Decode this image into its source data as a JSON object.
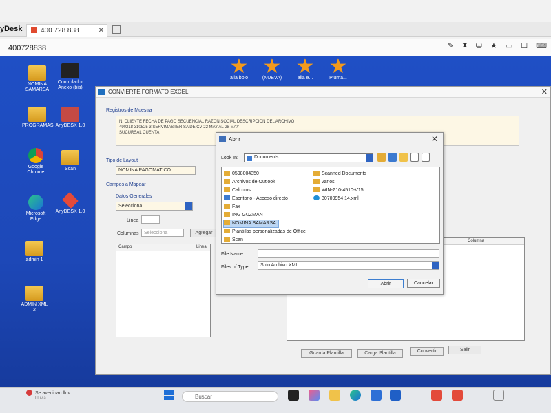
{
  "anydesk": {
    "brand": "yDesk",
    "tab_label": "400 728 838",
    "address": "400728838",
    "toolbar_icons": [
      "edit-icon",
      "hourglass-icon",
      "database-icon",
      "star-icon",
      "monitor-icon",
      "chat-icon",
      "keyboard-icon"
    ]
  },
  "desktop": {
    "left_icons": [
      {
        "label": "NOMINA SAMARSA",
        "icon": "folder-icon"
      },
      {
        "label": "Controlador Anexo (bis)",
        "icon": "app-icon"
      },
      {
        "label": "PROGRAMAS",
        "icon": "folder-icon"
      },
      {
        "label": "AnyDESK 1.0",
        "icon": "app-icon"
      },
      {
        "label": "Google Chrome",
        "icon": "chrome-icon"
      },
      {
        "label": "Scan",
        "icon": "folder-icon"
      },
      {
        "label": "Microsoft Edge",
        "icon": "edge-icon"
      },
      {
        "label": "AnyDESK 1.0",
        "icon": "anydesk-icon"
      },
      {
        "label": "admin 1",
        "icon": "folder-icon"
      },
      {
        "label": "ADMIN XML 2",
        "icon": "folder-icon"
      }
    ],
    "top_icons": [
      {
        "label": "alla bolo"
      },
      {
        "label": "(NUEVA)"
      },
      {
        "label": "alla e..."
      },
      {
        "label": "Pluma..."
      }
    ]
  },
  "app": {
    "title": "CONVIERTE FORMATO EXCEL",
    "registros_label": "Registros de Muestra",
    "sample_line1": "N. CLIENTE FECHA DE PAGO SECUENCIAL RAZON SOCIAL DESCRIPCION DEL ARCHIVO",
    "sample_line2": "490218 310525 3 SERVIMASTER SA DE CV 22 MAY AL 28 MAY",
    "sample_line3": "SUCURSAL CUENTA",
    "tipo_layout_label": "Tipo de Layout",
    "tipo_layout_value": "NOMINA PAGOMATICO",
    "campos_label": "Campos a Mapear",
    "datos_generales_label": "Datos Generales",
    "datos_generales_value": "Selecciona",
    "linea_label": "Linea",
    "columnas_label": "Columnas",
    "columnas_value": "Selecciona",
    "grid_col_campo": "Campo",
    "grid_col_linea": "Linea",
    "grid_col_columna": "Columna",
    "btn_agregar": "Agregar",
    "btn_guardar": "Guarda Plantilla",
    "btn_carga": "Carga Plantilla",
    "btn_convertir": "Convertir",
    "btn_salir": "Salir"
  },
  "dialog": {
    "title": "Abrir",
    "look_in_label": "Look In:",
    "look_in_value": "Documents",
    "left_items": [
      {
        "name": "0598004350",
        "type": "folder"
      },
      {
        "name": "Archivos de Outlook",
        "type": "folder"
      },
      {
        "name": "Calculos",
        "type": "folder"
      },
      {
        "name": "Escritorio - Acceso directo",
        "type": "shortcut"
      },
      {
        "name": "Fax",
        "type": "folder"
      },
      {
        "name": "ING GUZMAN",
        "type": "folder"
      },
      {
        "name": "NOMINA SAMARSA",
        "type": "folder",
        "selected": true
      },
      {
        "name": "Plantillas personalizadas de Office",
        "type": "folder"
      },
      {
        "name": "Scan",
        "type": "folder"
      }
    ],
    "right_items": [
      {
        "name": "Scanned Documents",
        "type": "folder"
      },
      {
        "name": "varios",
        "type": "folder"
      },
      {
        "name": "WIN-Z10-4510-V15",
        "type": "folder"
      },
      {
        "name": "30709954 14.xml",
        "type": "xml"
      }
    ],
    "file_name_label": "File Name:",
    "file_name_value": "",
    "files_of_type_label": "Files of Type:",
    "files_of_type_value": "Solo Archivo XML",
    "btn_open": "Abrir",
    "btn_cancel": "Cancelar"
  },
  "taskbar": {
    "notification": "Se avecinan lluv...",
    "notification_sub": "Lluvia",
    "search_placeholder": "Buscar"
  }
}
